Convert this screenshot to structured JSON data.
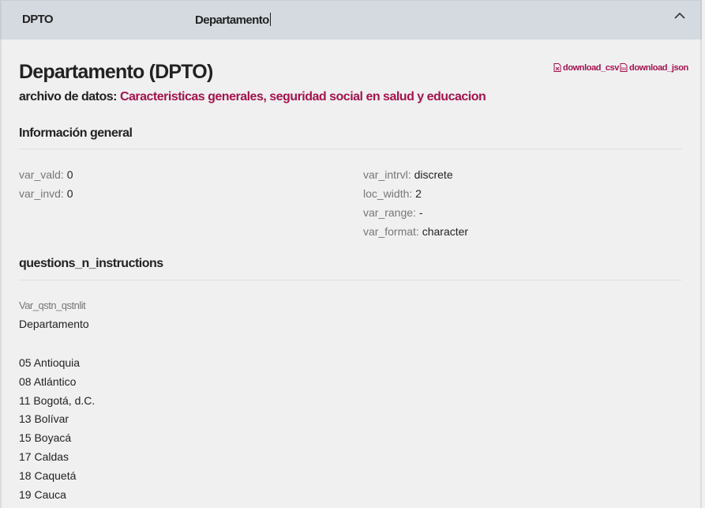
{
  "header": {
    "code": "DPTO",
    "name": "Departamento"
  },
  "variable": {
    "title": "Departamento (DPTO)",
    "file_label": "archivo de datos:",
    "file_name": "Caracteristicas generales, seguridad social en salud y educacion"
  },
  "downloads": {
    "csv": "download_csv",
    "json": "download_json"
  },
  "general": {
    "title": "Información general",
    "left": [
      {
        "k": "var_vald:",
        "v": "0"
      },
      {
        "k": "var_invd:",
        "v": "0"
      }
    ],
    "right": [
      {
        "k": "var_intrvl:",
        "v": "discrete"
      },
      {
        "k": "loc_width:",
        "v": "2"
      },
      {
        "k": "var_range:",
        "v": "-"
      },
      {
        "k": "var_format:",
        "v": "character"
      }
    ]
  },
  "questions": {
    "title": "questions_n_instructions",
    "label": "Var_qstn_qstnlit",
    "text": "Departamento",
    "categories": [
      "05 Antioquia",
      "08 Atlántico",
      "11 Bogotá, d.C.",
      "13 Bolívar",
      "15 Boyacá",
      "17 Caldas",
      "18 Caquetá",
      "19 Cauca"
    ]
  }
}
